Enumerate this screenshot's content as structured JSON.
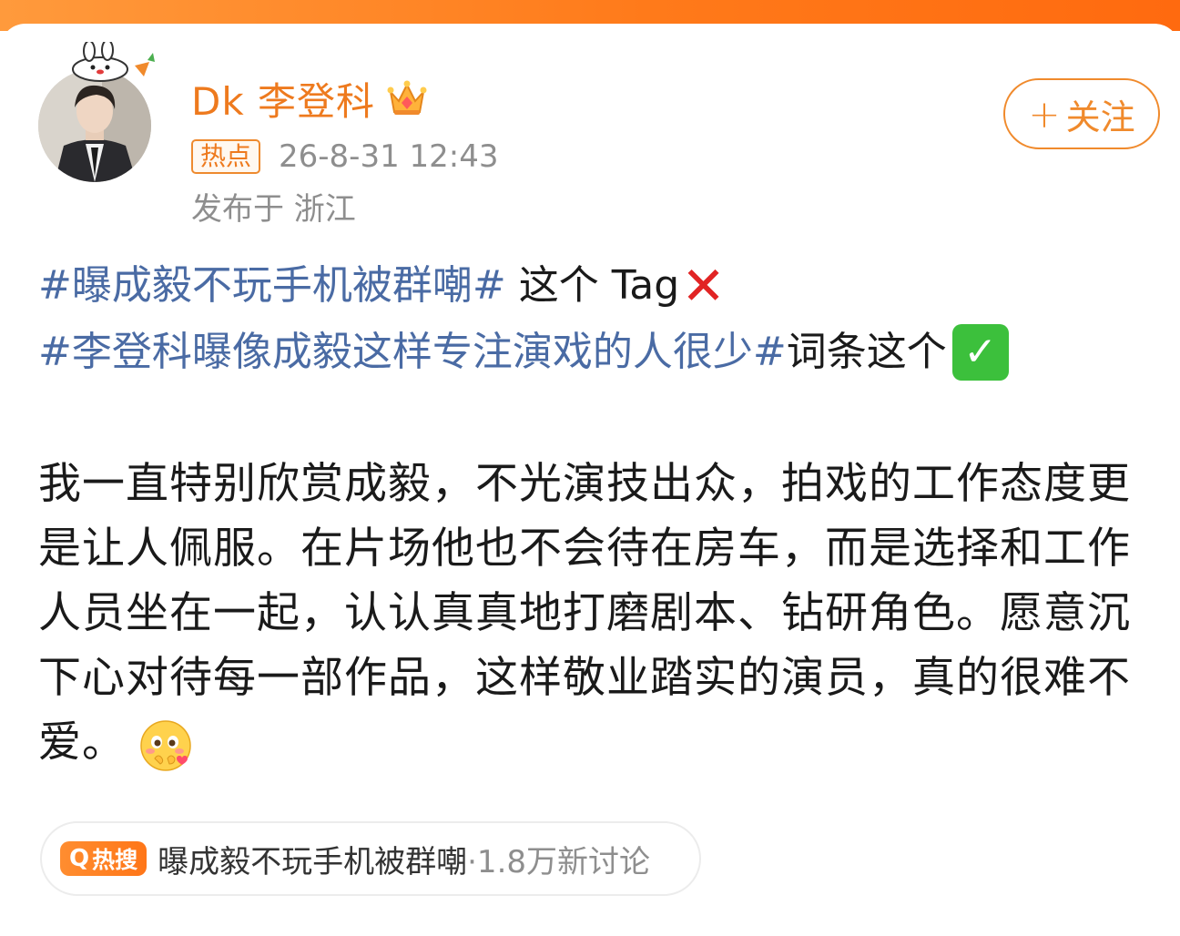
{
  "user": {
    "name": "Dk 李登科",
    "hot_badge": "热点",
    "timestamp": "26-8-31 12:43",
    "location": "发布于 浙江"
  },
  "follow_button": {
    "plus": "+",
    "label": "关注"
  },
  "post": {
    "line1": {
      "hashtag": "#曝成毅不玩手机被群嘲#",
      "text": " 这个 Tag"
    },
    "line2": {
      "hashtag": "#李登科曝像成毅这样专注演戏的人很少#",
      "text": "词条这个"
    },
    "body": "我一直特别欣赏成毅，不光演技出众，拍戏的工作态度更是让人佩服。在片场他也不会待在房车，而是选择和工作人员坐在一起，认认真真地打磨剧本、钻研角色。愿意沉下心对待每一部作品，这样敬业踏实的演员，真的很难不爱。"
  },
  "hot_search": {
    "badge_label": "热搜",
    "topic": "曝成毅不玩手机被群嘲",
    "count": "·1.8万新讨论"
  },
  "colors": {
    "accent": "#ee7a1e",
    "hashtag": "#4a6ba4",
    "meta_gray": "#8e8e8e"
  },
  "icons": [
    "rabbit-decoration-icon",
    "crown-icon",
    "cross-mark-icon",
    "check-mark-icon",
    "blushing-emoji-icon",
    "search-icon"
  ]
}
